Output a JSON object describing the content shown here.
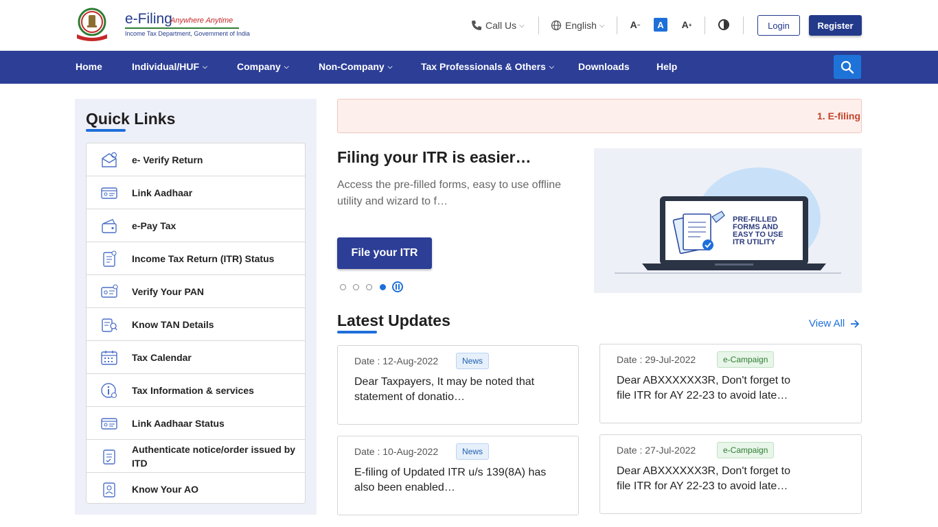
{
  "header": {
    "logo_title": "e-Filing",
    "logo_tagline": "Anywhere Anytime",
    "logo_subtitle": "Income Tax Department, Government of India",
    "call_us": "Call Us",
    "language": "English",
    "font_decrease": "A",
    "font_normal": "A",
    "font_increase": "A",
    "login": "Login",
    "register": "Register"
  },
  "nav": {
    "items": [
      {
        "label": "Home"
      },
      {
        "label": "Individual/HUF"
      },
      {
        "label": "Company"
      },
      {
        "label": "Non-Company"
      },
      {
        "label": "Tax Professionals & Others"
      },
      {
        "label": "Downloads"
      },
      {
        "label": "Help"
      }
    ]
  },
  "quick_links": {
    "title": "Quick Links",
    "items": [
      {
        "label": "e- Verify Return",
        "icon": "verify-return-icon"
      },
      {
        "label": "Link Aadhaar",
        "icon": "aadhaar-card-icon"
      },
      {
        "label": "e-Pay Tax",
        "icon": "wallet-icon"
      },
      {
        "label": "Income Tax Return (ITR) Status",
        "icon": "document-icon"
      },
      {
        "label": "Verify Your PAN",
        "icon": "pan-card-icon"
      },
      {
        "label": "Know TAN Details",
        "icon": "tan-document-icon"
      },
      {
        "label": "Tax Calendar",
        "icon": "calendar-icon"
      },
      {
        "label": "Tax Information & services",
        "icon": "info-icon"
      },
      {
        "label": "Link Aadhaar Status",
        "icon": "aadhaar-status-icon"
      },
      {
        "label": "Authenticate notice/order issued by ITD",
        "icon": "notice-icon"
      },
      {
        "label": "Know Your AO",
        "icon": "officer-icon"
      }
    ]
  },
  "marquee": {
    "text": "1. E-filing"
  },
  "hero": {
    "title": "Filing your ITR is easier…",
    "description": "Access the pre-filled forms, easy to use offline utility and wizard to f…",
    "button": "File your ITR",
    "image_caption": "PRE-FILLED FORMS AND EASY TO USE ITR UTILITY",
    "active_slide": 4,
    "total_slides": 4
  },
  "latest_updates": {
    "title": "Latest Updates",
    "view_all": "View All",
    "cards": [
      {
        "date": "Date : 12-Aug-2022",
        "badge": "News",
        "text": "Dear Taxpayers, It may be noted that statement of donatio…"
      },
      {
        "date": "Date : 29-Jul-2022",
        "badge": "e-Campaign",
        "text": "Dear ABXXXXXX3R, Don't forget to file ITR for AY 22-23 to avoid late…"
      },
      {
        "date": "Date : 10-Aug-2022",
        "badge": "News",
        "text": "E-filing of Updated ITR u/s 139(8A) has also been enabled…"
      },
      {
        "date": "Date : 27-Jul-2022",
        "badge": "e-Campaign",
        "text": "Dear ABXXXXXX3R, Don't forget to file ITR for AY 22-23 to avoid late…"
      }
    ]
  },
  "colors": {
    "primary": "#2c3e96",
    "accent": "#1e6fd9",
    "marquee_bg": "#fdefec",
    "marquee_text": "#c1442b"
  }
}
